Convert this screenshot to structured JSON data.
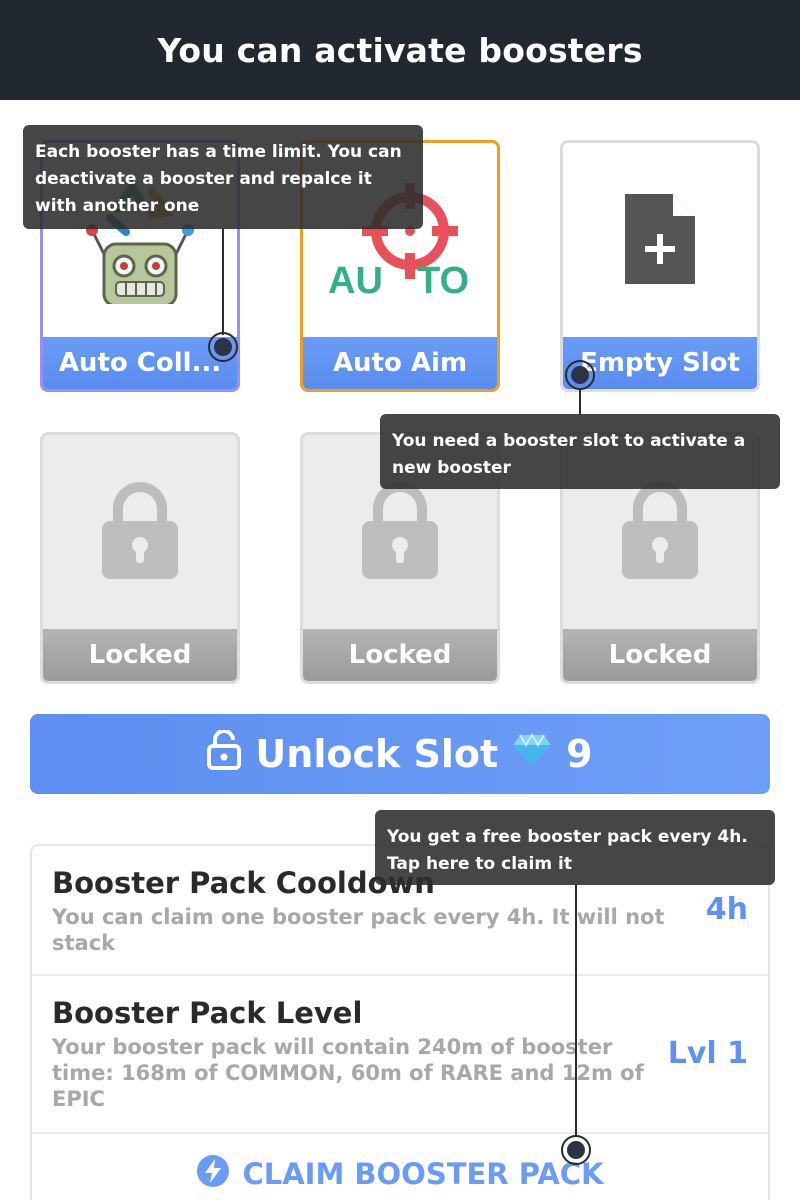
{
  "header": {
    "title": "You can activate boosters"
  },
  "slots": [
    {
      "label": "Auto Coll...",
      "icon": "robot-icon",
      "state": "active"
    },
    {
      "label": "Auto Aim",
      "icon": "crosshair-icon",
      "icon_text_left": "AU",
      "icon_text_right": "TO",
      "state": "active"
    },
    {
      "label": "Empty Slot",
      "icon": "add-file-icon",
      "state": "empty"
    },
    {
      "label": "Locked",
      "icon": "lock-icon",
      "state": "locked"
    },
    {
      "label": "Locked",
      "icon": "lock-icon",
      "state": "locked"
    },
    {
      "label": "Locked",
      "icon": "lock-icon",
      "state": "locked"
    }
  ],
  "unlock": {
    "label": "Unlock Slot",
    "cost": "9",
    "icon": "unlocked-padlock-icon",
    "currency_icon": "diamond-icon"
  },
  "info": {
    "cooldown": {
      "title": "Booster Pack Cooldown",
      "description": "You can claim one booster pack every 4h. It will not stack",
      "value": "4h"
    },
    "level": {
      "title": "Booster Pack Level",
      "description": "Your booster pack will contain 240m of booster time: 168m of COMMON, 60m of RARE and 12m of EPIC",
      "value": "Lvl 1"
    },
    "claim": {
      "label": "CLAIM BOOSTER PACK",
      "icon": "lightning-icon"
    }
  },
  "tooltips": {
    "booster_limit": "Each booster has a time limit. You can deactivate a booster and repalce it with another one",
    "slot_needed": "You need a booster slot to activate a new booster",
    "free_pack": "You get a free booster pack every 4h. Tap here to claim it"
  },
  "colors": {
    "header_bg": "#222830",
    "accent_blue": "#5e92f2",
    "active_border_purple": "#9a8cf2",
    "active_border_orange": "#f0a020",
    "locked_gray": "#a8a8a8"
  }
}
